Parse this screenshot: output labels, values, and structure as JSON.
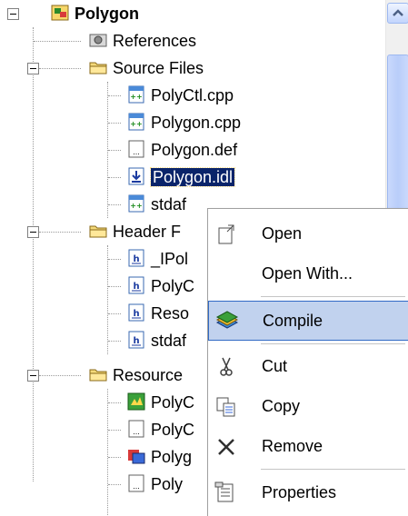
{
  "tree": {
    "root": {
      "label": "Polygon"
    },
    "references": {
      "label": "References"
    },
    "source_files": {
      "label": "Source Files",
      "items": [
        "PolyCtl.cpp",
        "Polygon.cpp",
        "Polygon.def",
        "Polygon.idl",
        "stdaf"
      ]
    },
    "header_files": {
      "label": "Header F",
      "items": [
        "_IPol",
        "PolyC",
        "Reso",
        "stdaf"
      ]
    },
    "resource_files": {
      "label": "Resource",
      "items": [
        "PolyC",
        "PolyC",
        "Polyg",
        "Poly"
      ]
    }
  },
  "context_menu": {
    "items": [
      {
        "label": "Open",
        "icon": "open-icon"
      },
      {
        "label": "Open With...",
        "icon": "none"
      },
      {
        "label": "Compile",
        "icon": "compile-icon",
        "highlighted": true
      },
      {
        "label": "Cut",
        "icon": "scissors-icon"
      },
      {
        "label": "Copy",
        "icon": "copy-icon"
      },
      {
        "label": "Remove",
        "icon": "remove-x-icon"
      },
      {
        "label": "Properties",
        "icon": "properties-icon"
      }
    ]
  },
  "colors": {
    "selection": "#0a246a",
    "menu_highlight": "#c1d2ee",
    "menu_highlight_border": "#316ac5",
    "folder": "#ffe07a"
  }
}
